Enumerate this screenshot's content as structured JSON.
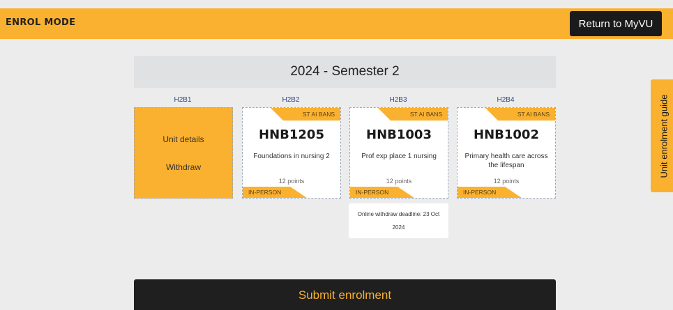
{
  "header": {
    "title": "ENROL MODE",
    "return_label": "Return to MyVU",
    "accent_color": "#fbb130"
  },
  "semester": {
    "title": "2024 - Semester 2"
  },
  "blocks": [
    {
      "label": "H2B1",
      "actions": [
        "Unit details",
        "Withdraw"
      ]
    },
    {
      "label": "H2B2",
      "campus": "ST AI BANS",
      "code": "HNB1205",
      "name": "Foundations in nursing 2",
      "points": "12 points",
      "mode": "IN-PERSON"
    },
    {
      "label": "H2B3",
      "campus": "ST AI BANS",
      "code": "HNB1003",
      "name": "Prof exp place 1 nursing",
      "points": "12 points",
      "mode": "IN-PERSON",
      "deadline": "Online withdraw deadline: 23 Oct 2024"
    },
    {
      "label": "H2B4",
      "campus": "ST AI BANS",
      "code": "HNB1002",
      "name": "Primary health care across the lifespan",
      "points": "12 points",
      "mode": "IN-PERSON"
    }
  ],
  "side_tab": {
    "label": "Unit enrolment guide"
  },
  "footer": {
    "submit_label": "Submit enrolment"
  }
}
